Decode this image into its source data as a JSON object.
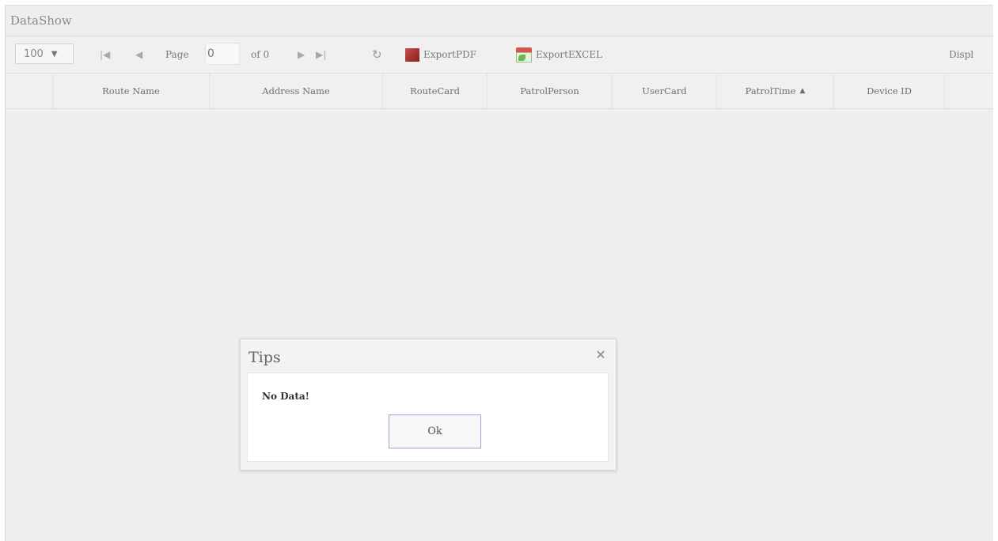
{
  "panel": {
    "title": "DataShow"
  },
  "toolbar": {
    "page_size": "100",
    "page_label": "Page",
    "page_value": "0",
    "of_label": "of 0",
    "export_pdf": "ExportPDF",
    "export_excel": "ExportEXCEL",
    "display_text": "Displ"
  },
  "grid": {
    "columns": [
      "Route Name",
      "Address Name",
      "RouteCard",
      "PatrolPerson",
      "UserCard",
      "PatrolTime",
      "Device ID"
    ],
    "sorted_column": "PatrolTime",
    "sort_direction": "ascending"
  },
  "dialog": {
    "title": "Tips",
    "message": "No Data!",
    "ok_label": "Ok"
  }
}
